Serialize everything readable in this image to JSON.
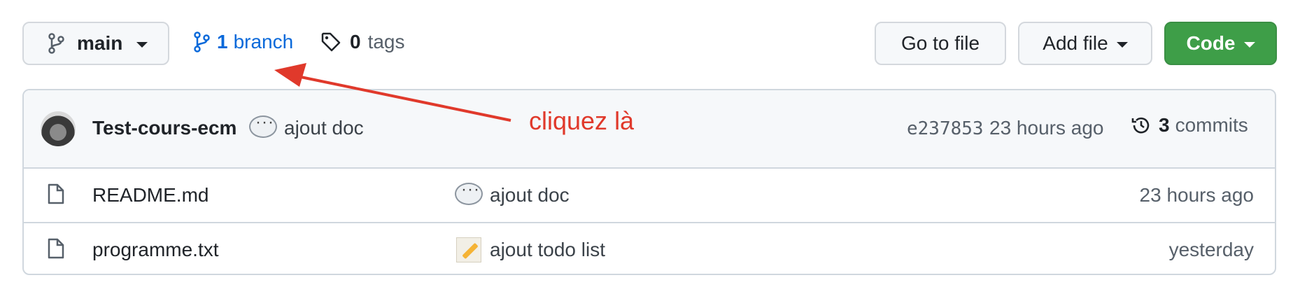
{
  "toolbar": {
    "branch_select": "main",
    "branch_count": "1",
    "branch_label": "branch",
    "tag_count": "0",
    "tag_label": "tags",
    "go_to_file": "Go to file",
    "add_file": "Add file",
    "code": "Code"
  },
  "latest_commit": {
    "author": "Test-cours-ecm",
    "message": "ajout doc",
    "sha": "e237853",
    "time": "23 hours ago",
    "commit_count": "3",
    "commit_label": "commits"
  },
  "files": [
    {
      "name": "README.md",
      "message": "ajout doc",
      "time": "23 hours ago",
      "emoji": "speech-bubble-icon"
    },
    {
      "name": "programme.txt",
      "message": "ajout todo list",
      "time": "yesterday",
      "emoji": "memo-pencil-icon"
    }
  ],
  "annotation": {
    "text": "cliquez là",
    "color": "#e0392b"
  },
  "colors": {
    "link": "#0969da",
    "code_button": "#3e9e48"
  }
}
